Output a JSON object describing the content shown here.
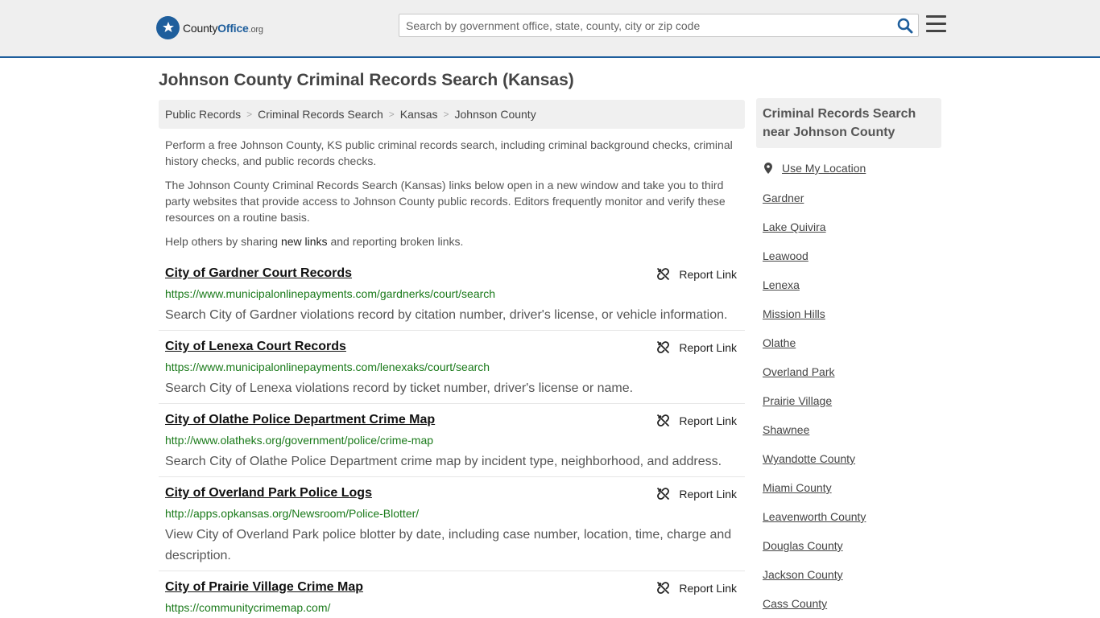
{
  "header": {
    "logo_county": "County",
    "logo_office": "Office",
    "logo_tld": ".org",
    "search_placeholder": "Search by government office, state, county, city or zip code",
    "brand_color": "#1e5e9c"
  },
  "page": {
    "title": "Johnson County Criminal Records Search (Kansas)"
  },
  "breadcrumb": [
    "Public Records",
    "Criminal Records Search",
    "Kansas",
    "Johnson County"
  ],
  "intro": {
    "p1": "Perform a free Johnson County, KS public criminal records search, including criminal background checks, criminal history checks, and public records checks.",
    "p2": "The Johnson County Criminal Records Search (Kansas) links below open in a new window and take you to third party websites that provide access to Johnson County public records. Editors frequently monitor and verify these resources on a routine basis.",
    "p3_before": "Help others by sharing ",
    "p3_link": "new links",
    "p3_after": " and reporting broken links."
  },
  "report_label": "Report Link",
  "listings": [
    {
      "title": "City of Gardner Court Records",
      "url": "https://www.municipalonlinepayments.com/gardnerks/court/search",
      "desc": "Search City of Gardner violations record by citation number, driver's license, or vehicle information."
    },
    {
      "title": "City of Lenexa Court Records",
      "url": "https://www.municipalonlinepayments.com/lenexaks/court/search",
      "desc": "Search City of Lenexa violations record by ticket number, driver's license or name."
    },
    {
      "title": "City of Olathe Police Department Crime Map",
      "url": "http://www.olatheks.org/government/police/crime-map",
      "desc": "Search City of Olathe Police Department crime map by incident type, neighborhood, and address."
    },
    {
      "title": "City of Overland Park Police Logs",
      "url": "http://apps.opkansas.org/Newsroom/Police-Blotter/",
      "desc": "View City of Overland Park police blotter by date, including case number, location, time, charge and description."
    },
    {
      "title": "City of Prairie Village Crime Map",
      "url": "https://communitycrimemap.com/",
      "desc": ""
    }
  ],
  "sidebar": {
    "heading": "Criminal Records Search near Johnson County",
    "use_location": "Use My Location",
    "links": [
      "Gardner",
      "Lake Quivira",
      "Leawood",
      "Lenexa",
      "Mission Hills",
      "Olathe",
      "Overland Park",
      "Prairie Village",
      "Shawnee",
      "Wyandotte County",
      "Miami County",
      "Leavenworth County",
      "Douglas County",
      "Jackson County",
      "Cass County"
    ]
  }
}
